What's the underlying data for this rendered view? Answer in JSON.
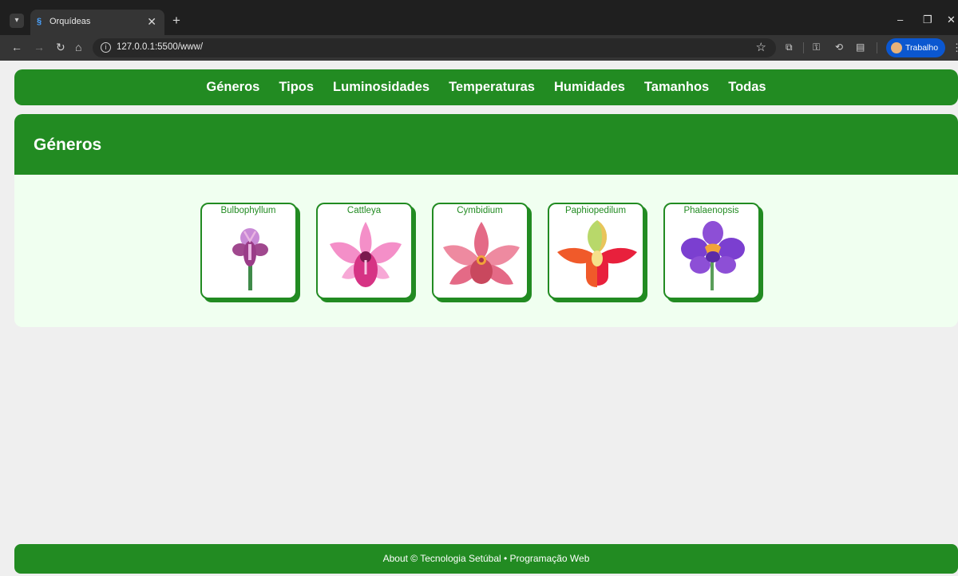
{
  "browser": {
    "tab_title": "Orquídeas",
    "url": "127.0.0.1:5500/www/",
    "profile_label": "Trabalho",
    "close_symbol": "✕",
    "new_tab_symbol": "+",
    "minimize_symbol": "–",
    "restore_symbol": "❐",
    "window_close_symbol": "✕"
  },
  "nav": {
    "items": [
      {
        "label": "Géneros"
      },
      {
        "label": "Tipos"
      },
      {
        "label": "Luminosidades"
      },
      {
        "label": "Temperaturas"
      },
      {
        "label": "Humidades"
      },
      {
        "label": "Tamanhos"
      },
      {
        "label": "Todas"
      }
    ]
  },
  "section": {
    "title": "Géneros",
    "cards": [
      {
        "label": "Bulbophyllum",
        "icon": "bulbophyllum-icon"
      },
      {
        "label": "Cattleya",
        "icon": "cattleya-icon"
      },
      {
        "label": "Cymbidium",
        "icon": "cymbidium-icon"
      },
      {
        "label": "Paphiopedilum",
        "icon": "paphiopedilum-icon"
      },
      {
        "label": "Phalaenopsis",
        "icon": "phalaenopsis-icon"
      }
    ]
  },
  "footer": {
    "text": "About © Tecnologia Setúbal • Programação Web"
  },
  "colors": {
    "brand_green": "#228b22",
    "section_bg": "#f0fff0",
    "page_bg": "#efefef"
  }
}
